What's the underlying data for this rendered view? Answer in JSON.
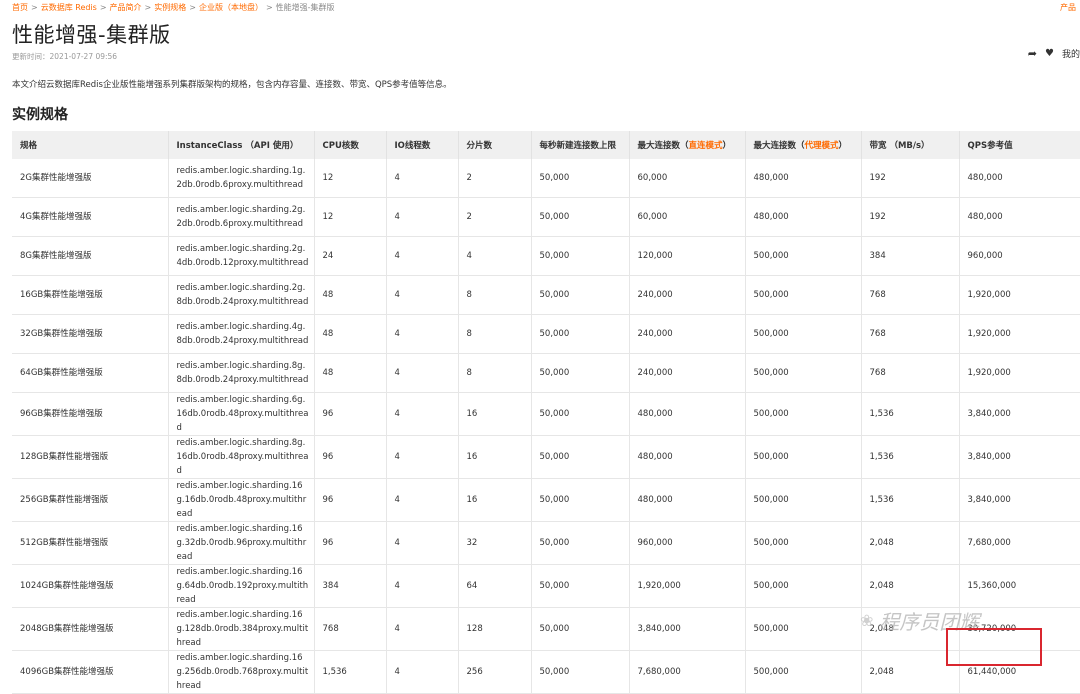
{
  "breadcrumb": [
    {
      "label": "首页"
    },
    {
      "label": "云数据库 Redis"
    },
    {
      "label": "产品简介"
    },
    {
      "label": "实例规格"
    },
    {
      "label": "企业版（本地盘）"
    },
    {
      "label": "性能增强-集群版"
    }
  ],
  "top_right_link": "产品",
  "page_title": "性能增强-集群版",
  "update_time": "更新时间：2021-07-27 09:56",
  "tools": {
    "my_label": "我的"
  },
  "intro": "本文介绍云数据库Redis企业版性能增强系列集群版架构的规格，包含内存容量、连接数、带宽、QPS参考值等信息。",
  "section_title": "实例规格",
  "table": {
    "headers": [
      "规格",
      "InstanceClass （API 使用）",
      "CPU核数",
      "IO线程数",
      "分片数",
      "每秒新建连接数上限",
      "最大连接数（",
      "直连模式",
      "）",
      "最大连接数（",
      "代理模式",
      "）",
      "带宽 （MB/s）",
      "QPS参考值"
    ],
    "rows": [
      [
        "2G集群性能增强版",
        "redis.amber.logic.sharding.1g.2db.0rodb.6proxy.multithread",
        "12",
        "4",
        "2",
        "50,000",
        "60,000",
        "480,000",
        "192",
        "480,000"
      ],
      [
        "4G集群性能增强版",
        "redis.amber.logic.sharding.2g.2db.0rodb.6proxy.multithread",
        "12",
        "4",
        "2",
        "50,000",
        "60,000",
        "480,000",
        "192",
        "480,000"
      ],
      [
        "8G集群性能增强版",
        "redis.amber.logic.sharding.2g.4db.0rodb.12proxy.multithread",
        "24",
        "4",
        "4",
        "50,000",
        "120,000",
        "500,000",
        "384",
        "960,000"
      ],
      [
        "16GB集群性能增强版",
        "redis.amber.logic.sharding.2g.8db.0rodb.24proxy.multithread",
        "48",
        "4",
        "8",
        "50,000",
        "240,000",
        "500,000",
        "768",
        "1,920,000"
      ],
      [
        "32GB集群性能增强版",
        "redis.amber.logic.sharding.4g.8db.0rodb.24proxy.multithread",
        "48",
        "4",
        "8",
        "50,000",
        "240,000",
        "500,000",
        "768",
        "1,920,000"
      ],
      [
        "64GB集群性能增强版",
        "redis.amber.logic.sharding.8g.8db.0rodb.24proxy.multithread",
        "48",
        "4",
        "8",
        "50,000",
        "240,000",
        "500,000",
        "768",
        "1,920,000"
      ],
      [
        "96GB集群性能增强版",
        "redis.amber.logic.sharding.6g.16db.0rodb.48proxy.multithread",
        "96",
        "4",
        "16",
        "50,000",
        "480,000",
        "500,000",
        "1,536",
        "3,840,000"
      ],
      [
        "128GB集群性能增强版",
        "redis.amber.logic.sharding.8g.16db.0rodb.48proxy.multithread",
        "96",
        "4",
        "16",
        "50,000",
        "480,000",
        "500,000",
        "1,536",
        "3,840,000"
      ],
      [
        "256GB集群性能增强版",
        "redis.amber.logic.sharding.16g.16db.0rodb.48proxy.multithread",
        "96",
        "4",
        "16",
        "50,000",
        "480,000",
        "500,000",
        "1,536",
        "3,840,000"
      ],
      [
        "512GB集群性能增强版",
        "redis.amber.logic.sharding.16g.32db.0rodb.96proxy.multithread",
        "96",
        "4",
        "32",
        "50,000",
        "960,000",
        "500,000",
        "2,048",
        "7,680,000"
      ],
      [
        "1024GB集群性能增强版",
        "redis.amber.logic.sharding.16g.64db.0rodb.192proxy.multithread",
        "384",
        "4",
        "64",
        "50,000",
        "1,920,000",
        "500,000",
        "2,048",
        "15,360,000"
      ],
      [
        "2048GB集群性能增强版",
        "redis.amber.logic.sharding.16g.128db.0rodb.384proxy.multithread",
        "768",
        "4",
        "128",
        "50,000",
        "3,840,000",
        "500,000",
        "2,048",
        "30,720,000"
      ],
      [
        "4096GB集群性能增强版",
        "redis.amber.logic.sharding.16g.256db.0rodb.768proxy.multithread",
        "1,536",
        "4",
        "256",
        "50,000",
        "7,680,000",
        "500,000",
        "2,048",
        "61,440,000"
      ]
    ]
  },
  "watermark": "程序员团辉",
  "colors": {
    "accent": "#ff6a00",
    "highlight": "#d9262f",
    "header_bg": "#f0f0f0"
  }
}
